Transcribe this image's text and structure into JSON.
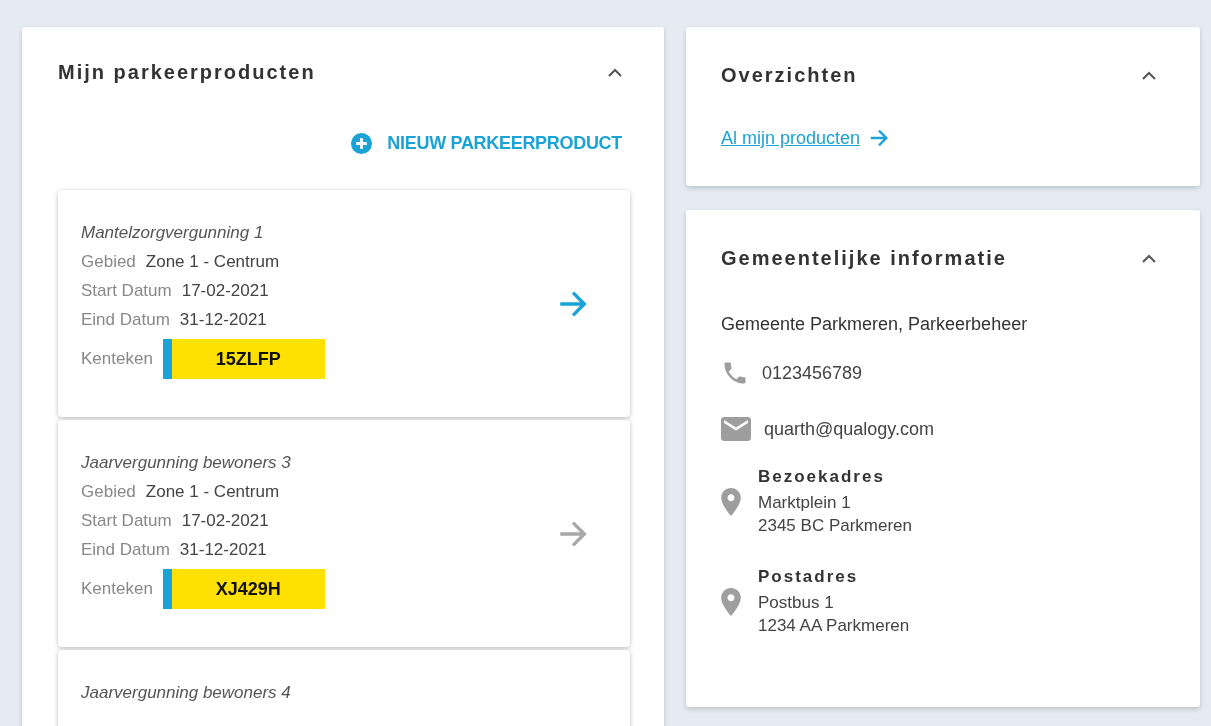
{
  "products_panel": {
    "title": "Mijn parkeerproducten",
    "expanded": true,
    "new_button": "NIEUW PARKEERPRODUCT",
    "products": [
      {
        "name": "Mantelzorgvergunning 1",
        "highlighted": true,
        "fields": [
          {
            "label": "Gebied",
            "value": "Zone 1 - Centrum"
          },
          {
            "label": "Start Datum",
            "value": "17-02-2021"
          },
          {
            "label": "Eind Datum",
            "value": "31-12-2021"
          }
        ],
        "plate_label": "Kenteken",
        "plate": "15ZLFP"
      },
      {
        "name": "Jaarvergunning bewoners 3",
        "highlighted": false,
        "fields": [
          {
            "label": "Gebied",
            "value": "Zone 1 - Centrum"
          },
          {
            "label": "Start Datum",
            "value": "17-02-2021"
          },
          {
            "label": "Eind Datum",
            "value": "31-12-2021"
          }
        ],
        "plate_label": "Kenteken",
        "plate": "XJ429H"
      },
      {
        "name": "Jaarvergunning bewoners 4"
      }
    ]
  },
  "overview_panel": {
    "title": "Overzichten",
    "expanded": true,
    "link": "Al mijn producten"
  },
  "municipal_panel": {
    "title": "Gemeentelijke informatie",
    "expanded": true,
    "organisation": "Gemeente Parkmeren, Parkeerbeheer",
    "contacts": [
      {
        "kind": "phone",
        "text": "0123456789"
      },
      {
        "kind": "email",
        "text": "quarth@qualogy.com"
      }
    ],
    "addresses": [
      {
        "title": "Bezoekadres",
        "lines": [
          "Marktplein 1",
          "2345 BC Parkmeren"
        ]
      },
      {
        "title": "Postadres",
        "lines": [
          "Postbus 1",
          "1234 AA Parkmeren"
        ]
      }
    ]
  }
}
